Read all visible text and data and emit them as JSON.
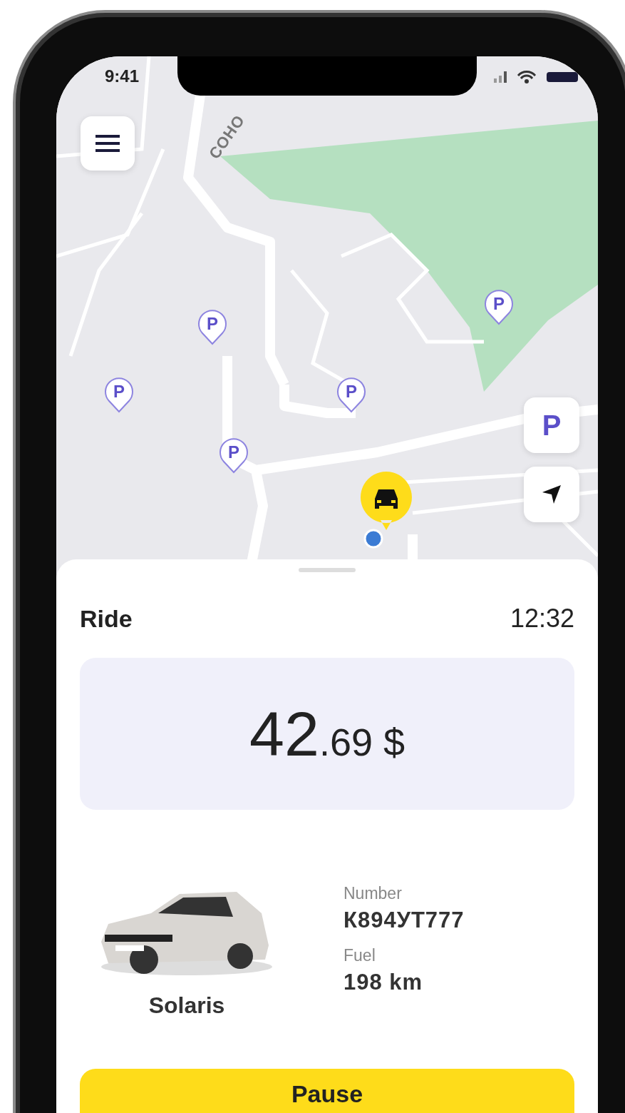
{
  "status_bar": {
    "time": "9:41"
  },
  "map": {
    "street_label": "СОНО",
    "parking_pins": [
      {
        "label": "P"
      },
      {
        "label": "P"
      },
      {
        "label": "P"
      },
      {
        "label": "P"
      },
      {
        "label": "P"
      }
    ],
    "parking_button": "P"
  },
  "ride": {
    "title": "Ride",
    "timer": "12:32",
    "price_whole": "42",
    "price_fraction": ".69",
    "currency": "$"
  },
  "car": {
    "model": "Solaris",
    "details": [
      {
        "label": "Number",
        "value": "К894УТ777"
      },
      {
        "label": "Fuel",
        "value": "198 km"
      }
    ]
  },
  "action_button": "Pause"
}
